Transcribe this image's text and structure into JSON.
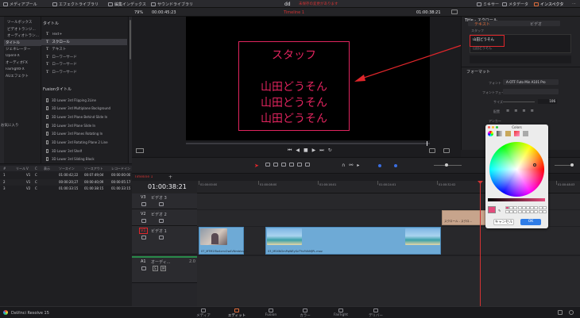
{
  "topbar": {
    "media_pool": "メディアプール",
    "effects_library": "エフェクトライブラリ",
    "edit_index": "編集インデックス",
    "sound_library": "サウンドライブラリ",
    "project_name": "dd",
    "status_text": "未保存の変更があります",
    "mixer": "ミキサー",
    "metadata": "メタデータ",
    "inspector": "インスペクタ"
  },
  "viewer_bar": {
    "zoom": "79%",
    "source_timecode": "00:00:45:23",
    "timeline_name": "Timeline 1",
    "record_timecode": "01:00:38:21"
  },
  "effects_panel": {
    "categories": [
      "ツールボックス",
      "ビデオトランジ...",
      "オーディオトラン...",
      "タイトル",
      "ジェネレーター",
      "OpenFX",
      "オーディオFX",
      "FairlightFX",
      "AUエフェクト"
    ],
    "selected_category_index": 3,
    "titles_header": "タイトル",
    "titles": [
      {
        "icon": "T",
        "label": "Text+"
      },
      {
        "icon": "T",
        "label": "スクロール"
      },
      {
        "icon": "T",
        "label": "テキスト"
      },
      {
        "icon": "T",
        "label": "ローワーサード"
      },
      {
        "icon": "T",
        "label": "ローワーサード"
      },
      {
        "icon": "T",
        "label": "ローワーサード"
      }
    ],
    "selected_title_index": 1,
    "fusion_header": "Fusionタイトル",
    "fusion_titles": [
      "3D Lower 3rd Flipping 2Line",
      "3D Lower 3rd Multiplane Background",
      "3D Lower 3rd Plane Behind Slide In",
      "3D Lower 3rd Plane Slide In",
      "3D Lower 3rd Planes Rotating In",
      "3D Lower 3rd Rotating Plane 2 Line",
      "3D Lower 3rd Shelf",
      "3D Lower 3rd Sliding Block"
    ]
  },
  "favorites_label": "お気に入り",
  "edit_index": {
    "columns": [
      "#",
      "リール",
      "V",
      "C",
      "表示",
      "ソースイン",
      "ソースアウト",
      "レコードイン"
    ],
    "rows": [
      [
        "1",
        "",
        "V1",
        "C",
        "",
        "01:00:42;22",
        "00:07:49;04",
        "00:00:00:00"
      ],
      [
        "2",
        "",
        "V1",
        "C",
        "",
        "00:00:20;27",
        "00:00:40;09",
        "00:00:05:17"
      ],
      [
        "3",
        "",
        "V2",
        "C",
        "",
        "01:00:33:15",
        "01:00:38:15",
        "01:00:33:15"
      ]
    ]
  },
  "viewer": {
    "credit_lines": [
      "スタッフ",
      "",
      "山田どうそん",
      "山田どうそん",
      "山田どうそん"
    ]
  },
  "timeline": {
    "timecode": "01:00:38:21",
    "ruler": [
      "01:00:00:00",
      "01:00:08:00",
      "01:00:16:01",
      "01:00:24:01",
      "01:00:32:02",
      "01:00:40:02",
      "01:00:48:03"
    ],
    "tracks": [
      {
        "id": "V3",
        "name": "ビデオ 3"
      },
      {
        "id": "V2",
        "name": "ビデオ 2"
      },
      {
        "id": "V1",
        "name": "ビデオ 1"
      },
      {
        "id": "A1",
        "name": "オーディ...",
        "meta": "2.0"
      }
    ],
    "clips": [
      {
        "name": "07_MTM1f5a4cmr2w4VNmblxsa3..."
      },
      {
        "name": "03_M5XNOmPqWEySvTYv9VkMJPL.mov"
      },
      {
        "name": "スクロール - スクロ..."
      }
    ]
  },
  "inspector": {
    "title": "Title - スクロール",
    "tabs": [
      "テキスト",
      "ビデオ"
    ],
    "active_tab_index": 0,
    "field_label": "スタッフ",
    "text_value": "山田どうそん",
    "text_value_2": "山田どうそん",
    "format_header": "フォーマット",
    "font_label": "フォント",
    "font_value": "A-OTF Futo Min A101 Pro",
    "font_face_label": "フォントフェイス",
    "size_label": "サイズ",
    "size_value": "106",
    "alignment_label": "配置",
    "anchor_label": "アンカー",
    "drop_shadow_label": "ドロ..."
  },
  "color_picker": {
    "title": "Colors",
    "cancel": "キャンセル",
    "ok": "OK",
    "current_color": "#e44a7c"
  },
  "bottom": {
    "app_name": "DaVinci Resolve 15",
    "pages": [
      "メディア",
      "エディット",
      "Fusion",
      "カラー",
      "Fairlight",
      "デリバー"
    ],
    "active_page_index": 1
  },
  "colors": {
    "accent": "#e0245e",
    "clip_blue": "#6eaad6",
    "timeline_red": "#d23333"
  }
}
